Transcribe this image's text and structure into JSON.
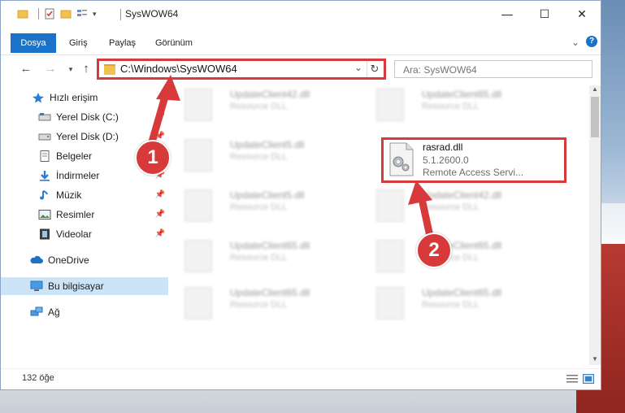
{
  "window": {
    "title": "SysWOW64"
  },
  "ribbon": {
    "tabs": [
      "Dosya",
      "Giriş",
      "Paylaş",
      "Görünüm"
    ]
  },
  "address": {
    "path": "C:\\Windows\\SysWOW64"
  },
  "search": {
    "placeholder": "Ara: SysWOW64"
  },
  "sidebar": {
    "items": [
      {
        "label": "Hızlı erişim",
        "icon": "star-icon"
      },
      {
        "label": "Yerel Disk (C:)",
        "icon": "drive-icon"
      },
      {
        "label": "Yerel Disk (D:)",
        "icon": "drive-icon"
      },
      {
        "label": "Belgeler",
        "icon": "document-icon"
      },
      {
        "label": "İndirmeler",
        "icon": "download-icon"
      },
      {
        "label": "Müzik",
        "icon": "music-icon"
      },
      {
        "label": "Resimler",
        "icon": "pictures-icon"
      },
      {
        "label": "Videolar",
        "icon": "video-icon"
      },
      {
        "label": "OneDrive",
        "icon": "cloud-icon"
      },
      {
        "label": "Bu bilgisayar",
        "icon": "computer-icon"
      },
      {
        "label": "Ağ",
        "icon": "network-icon"
      }
    ]
  },
  "files": {
    "left": [
      {
        "name": "UpdateClient42.dll",
        "desc": "Resource DLL"
      },
      {
        "name": "UpdateClient5.dll",
        "desc": "Resource DLL"
      },
      {
        "name": "UpdateClient5.dll",
        "desc": "Resource DLL"
      },
      {
        "name": "UpdateClient65.dll",
        "desc": "Resource DLL"
      },
      {
        "name": "UpdateClient65.dll",
        "desc": "Resource DLL"
      }
    ],
    "right": [
      {
        "name": "UpdateClient65.dll",
        "desc": "Resource DLL"
      },
      {
        "name": "UpdateClient42.dll",
        "desc": "Resource DLL"
      },
      {
        "name": "UpdateClient65.dll",
        "desc": "Resource DLL"
      },
      {
        "name": "UpdateClient65.dll",
        "desc": "Resource DLL"
      }
    ],
    "highlighted": {
      "name": "rasrad.dll",
      "version": "5.1.2600.0",
      "desc": "Remote Access Servi..."
    }
  },
  "status": {
    "count": "132 öğe"
  },
  "callouts": {
    "one": "1",
    "two": "2"
  },
  "colors": {
    "accent": "#1a73c9",
    "highlight": "#d8393b",
    "selection": "#cce4f7"
  }
}
